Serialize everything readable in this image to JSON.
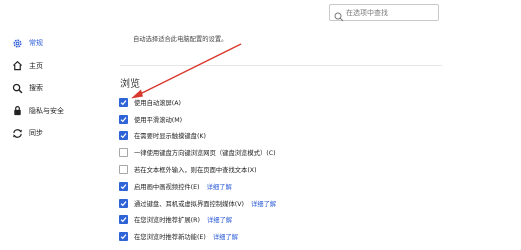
{
  "search": {
    "placeholder": "在选项中查找"
  },
  "sidebar": {
    "items": [
      {
        "label": "常规",
        "icon": "gear-icon",
        "active": true
      },
      {
        "label": "主页",
        "icon": "home-icon",
        "active": false
      },
      {
        "label": "搜索",
        "icon": "search-icon",
        "active": false
      },
      {
        "label": "隐私与安全",
        "icon": "lock-icon",
        "active": false
      },
      {
        "label": "同步",
        "icon": "sync-icon",
        "active": false
      }
    ]
  },
  "main": {
    "top_note": "自动选择适合此电脑配置的设置。",
    "section_title": "浏览",
    "options": [
      {
        "label": "使用自动滚屏(A)",
        "checked": true,
        "link": ""
      },
      {
        "label": "使用平滑滚动(M)",
        "checked": true,
        "link": ""
      },
      {
        "label": "在需要时显示触摸键盘(K)",
        "checked": true,
        "link": ""
      },
      {
        "label": "一律使用键盘方向键浏览网页（键盘浏览模式）(C)",
        "checked": false,
        "link": ""
      },
      {
        "label": "若在文本框外输入，则在页面中查找文本(X)",
        "checked": false,
        "link": ""
      },
      {
        "label": "启用画中画视频控件(E)",
        "checked": true,
        "link": "详细了解"
      },
      {
        "label": "通过键盘、耳机或虚拟界面控制媒体(V)",
        "checked": true,
        "link": "详细了解"
      },
      {
        "label": "在您浏览时推荐扩展(R)",
        "checked": true,
        "link": "详细了解"
      },
      {
        "label": "在您浏览时推荐新功能(E)",
        "checked": true,
        "link": "详细了解"
      }
    ]
  },
  "colors": {
    "accent": "#2f63d8",
    "link": "#2b5bd7",
    "arrow": "#d9382c"
  }
}
